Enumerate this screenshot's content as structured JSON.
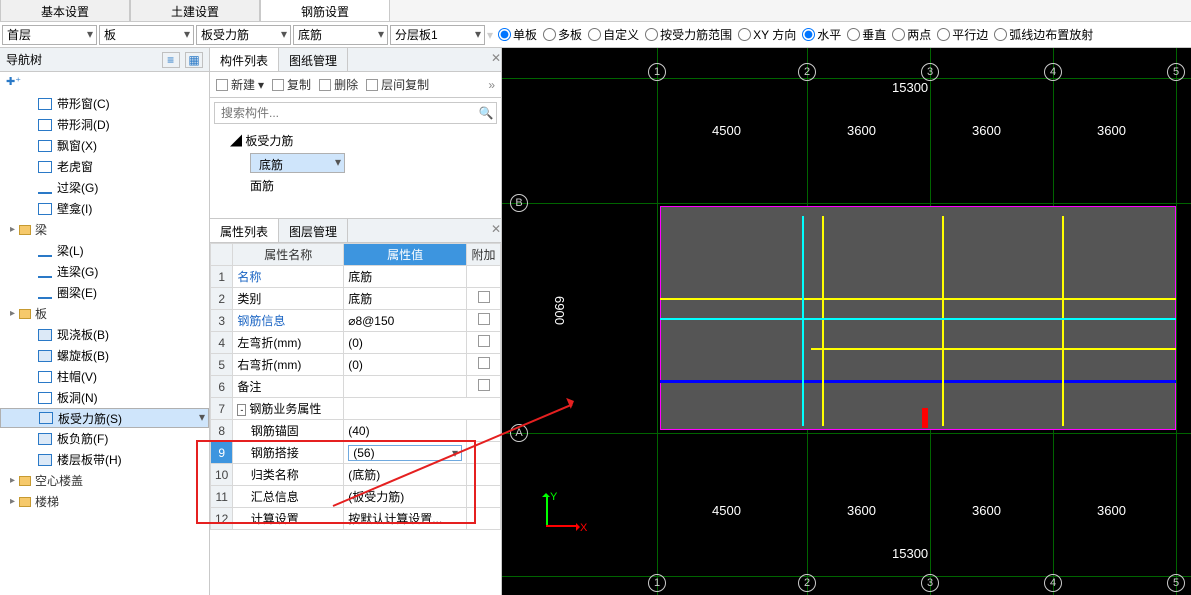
{
  "topTabs": [
    "基本设置",
    "土建设置",
    "钢筋设置"
  ],
  "topActive": 2,
  "selectors": [
    "首层",
    "板",
    "板受力筋",
    "底筋",
    "分层板1"
  ],
  "radios": [
    {
      "label": "单板",
      "checked": true
    },
    {
      "label": "多板",
      "checked": false
    },
    {
      "label": "自定义",
      "checked": false
    },
    {
      "label": "按受力筋范围",
      "checked": false
    },
    {
      "label": "XY 方向",
      "checked": false
    },
    {
      "label": "水平",
      "checked": true
    },
    {
      "label": "垂直",
      "checked": false
    },
    {
      "label": "两点",
      "checked": false
    },
    {
      "label": "平行边",
      "checked": false
    },
    {
      "label": "弧线边布置放射",
      "checked": false
    }
  ],
  "navTitle": "导航树",
  "treeItems": [
    {
      "label": "带形窗(C)",
      "ico": "ico-rect"
    },
    {
      "label": "带形洞(D)",
      "ico": "ico-rect"
    },
    {
      "label": "飘窗(X)",
      "ico": "ico-rect"
    },
    {
      "label": "老虎窗",
      "ico": "ico-rect"
    },
    {
      "label": "过梁(G)",
      "ico": "ico-beam"
    },
    {
      "label": "壁龛(I)",
      "ico": "ico-rect"
    }
  ],
  "treeBeamGroup": "梁",
  "treeBeamItems": [
    {
      "label": "梁(L)",
      "ico": "ico-beam"
    },
    {
      "label": "连梁(G)",
      "ico": "ico-beam"
    },
    {
      "label": "圈梁(E)",
      "ico": "ico-beam"
    }
  ],
  "treeSlabGroup": "板",
  "treeSlabItems": [
    {
      "label": "现浇板(B)",
      "ico": "ico-slab"
    },
    {
      "label": "螺旋板(B)",
      "ico": "ico-slab"
    },
    {
      "label": "柱帽(V)",
      "ico": "ico-rect"
    },
    {
      "label": "板洞(N)",
      "ico": "ico-rect"
    },
    {
      "label": "板受力筋(S)",
      "ico": "ico-slab",
      "sel": true
    },
    {
      "label": "板负筋(F)",
      "ico": "ico-slab"
    },
    {
      "label": "楼层板带(H)",
      "ico": "ico-slab"
    }
  ],
  "treeHollow": "空心楼盖",
  "treeStair": "楼梯",
  "compListTab": "构件列表",
  "drawMgmtTab": "图纸管理",
  "compToolbar": {
    "new": "新建",
    "copy": "复制",
    "del": "删除",
    "layerCopy": "层间复制"
  },
  "searchPh": "搜索构件...",
  "compTree": {
    "root": "板受力筋",
    "c1": "底筋",
    "c2": "面筋"
  },
  "propTab": "属性列表",
  "layerTab": "图层管理",
  "propHeaders": {
    "name": "属性名称",
    "val": "属性值",
    "extra": "附加"
  },
  "props": [
    {
      "n": "1",
      "name": "名称",
      "val": "底筋",
      "lnk": true
    },
    {
      "n": "2",
      "name": "类别",
      "val": "底筋",
      "chk": true
    },
    {
      "n": "3",
      "name": "钢筋信息",
      "val": "⌀8@150",
      "lnk": true,
      "chk": true
    },
    {
      "n": "4",
      "name": "左弯折(mm)",
      "val": "(0)",
      "chk": true
    },
    {
      "n": "5",
      "name": "右弯折(mm)",
      "val": "(0)",
      "chk": true
    },
    {
      "n": "6",
      "name": "备注",
      "val": "",
      "chk": true
    },
    {
      "n": "7",
      "name": "钢筋业务属性",
      "val": "",
      "grp": true
    },
    {
      "n": "8",
      "name": "钢筋锚固",
      "val": "(40)",
      "indent": true
    },
    {
      "n": "9",
      "name": "钢筋搭接",
      "val": "(56)",
      "indent": true,
      "dd": true,
      "active": true
    },
    {
      "n": "10",
      "name": "归类名称",
      "val": "(底筋)",
      "indent": true
    },
    {
      "n": "11",
      "name": "汇总信息",
      "val": "(板受力筋)",
      "indent": true
    },
    {
      "n": "12",
      "name": "计算设置",
      "val": "按默认计算设置...",
      "indent": true
    }
  ],
  "dims": {
    "topTotal": "15300",
    "botTotal": "15300",
    "spans": [
      "4500",
      "3600",
      "3600",
      "3600"
    ],
    "vside": "6900"
  },
  "gridLabels": {
    "cols": [
      "1",
      "2",
      "3",
      "4",
      "5"
    ],
    "rows": [
      "A",
      "B"
    ]
  },
  "axes": {
    "x": "X",
    "y": "Y"
  }
}
